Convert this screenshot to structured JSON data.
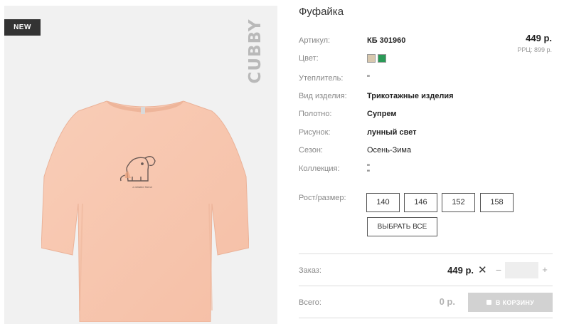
{
  "image_panel": {
    "badge": "NEW",
    "brand": "CUBBY",
    "print_caption": "a reliable friend",
    "colors": {
      "background": "#f1f1f1",
      "shirt": "#f8c9b2",
      "badge": "#333333"
    }
  },
  "product": {
    "title": "Фуфайка",
    "price": "449 р.",
    "rrp": "РРЦ: 899 р."
  },
  "specs": [
    {
      "label": "Артикул:",
      "value": "КБ 301960"
    },
    {
      "label": "Цвет:",
      "value": ""
    },
    {
      "label": "Утеплитель:",
      "value": "\""
    },
    {
      "label": "Вид изделия:",
      "value": "Трикотажные изделия"
    },
    {
      "label": "Полотно:",
      "value": "Супрем"
    },
    {
      "label": "Рисунок:",
      "value": "лунный свет"
    },
    {
      "label": "Сезон:",
      "value": "Осень-Зима"
    },
    {
      "label": "Коллекция:",
      "value": "\"",
      "value2": "\""
    }
  ],
  "color_swatches": [
    {
      "name": "beige",
      "color": "#d8c8ae"
    },
    {
      "name": "green",
      "color": "#2a9a57"
    }
  ],
  "sizes": {
    "label": "Рост/размер:",
    "options": [
      "140",
      "146",
      "152",
      "158"
    ],
    "select_all": "ВЫБРАТЬ ВСЕ"
  },
  "order": {
    "label": "Заказ:",
    "price": "449 р.",
    "times": "✕",
    "minus": "−",
    "plus": "+",
    "quantity": ""
  },
  "total": {
    "label": "Всего:",
    "value": "0 р.",
    "cart_button": "В КОРЗИНУ"
  }
}
